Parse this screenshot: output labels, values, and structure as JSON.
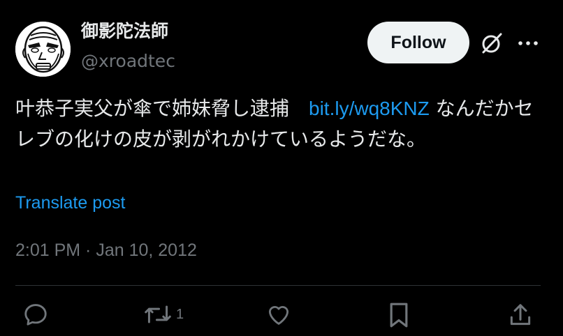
{
  "author": {
    "display_name": "御影陀法師",
    "handle": "@xroadtec",
    "avatar_icon": "manga-face-avatar"
  },
  "header": {
    "follow_label": "Follow",
    "grok_icon": "grok-icon",
    "more_icon": "more-icon"
  },
  "tweet": {
    "text_before_link": "叶恭子実父が傘で姉妹脅し逮捕　",
    "link_text": "bit.ly/wq8KNZ",
    "text_after_link": " なんだかセレブの化けの皮が剥がれかけているようだな。",
    "translate_label": "Translate post",
    "timestamp": "2:01 PM · Jan 10, 2012"
  },
  "actions": {
    "reply_icon": "reply-icon",
    "retweet_icon": "retweet-icon",
    "retweet_count": "1",
    "like_icon": "heart-icon",
    "bookmark_icon": "bookmark-icon",
    "share_icon": "share-icon"
  },
  "colors": {
    "background": "#000000",
    "text_primary": "#e7e9ea",
    "text_secondary": "#71767b",
    "link": "#1d9bf0",
    "follow_bg": "#eff3f4",
    "divider": "#2f3336"
  }
}
